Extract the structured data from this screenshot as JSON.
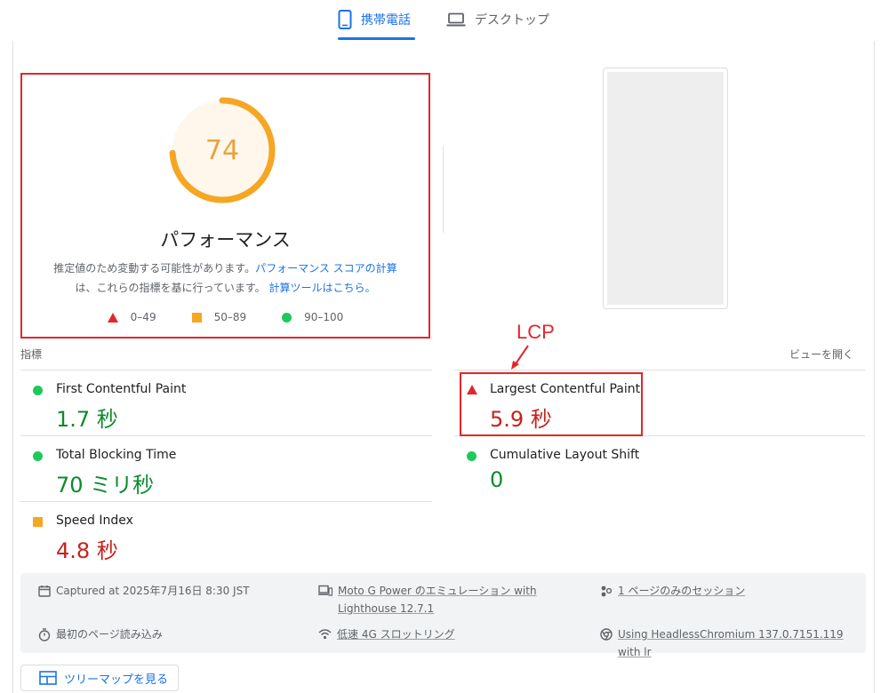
{
  "tabs": {
    "mobile_label": "携帯電話",
    "desktop_label": "デスクトップ"
  },
  "score": {
    "value": 74,
    "title": "パフォーマンス",
    "desc_part1": "推定値のため変動する可能性があります。",
    "desc_link1": "パフォーマンス スコアの計算",
    "desc_part2": "は、これらの指標を基に行っています。",
    "desc_link2": "計算ツールはこちら。",
    "legend": [
      "0–49",
      "50–89",
      "90–100"
    ],
    "color": "#f5a623"
  },
  "annotation": {
    "lcp_label": "LCP"
  },
  "metrics_header": {
    "label": "指標",
    "expand": "ビューを開く"
  },
  "metrics": {
    "fcp": {
      "name": "First Contentful Paint",
      "value": "1.7 秒",
      "status": "good"
    },
    "lcp": {
      "name": "Largest Contentful Paint",
      "value": "5.9 秒",
      "status": "poor"
    },
    "tbt": {
      "name": "Total Blocking Time",
      "value": "70 ミリ秒",
      "status": "good"
    },
    "cls": {
      "name": "Cumulative Layout Shift",
      "value": "0",
      "status": "good"
    },
    "si": {
      "name": "Speed Index",
      "value": "4.8 秒",
      "status": "poor"
    }
  },
  "info": {
    "captured": "Captured at 2025年7月16日 8:30 JST",
    "device_line1": "Moto G Power のエミュレーション with",
    "device_line2": "Lighthouse 12.7.1",
    "session": "1 ページのみのセッション",
    "load": "最初のページ読み込み",
    "network": "低速 4G スロットリング",
    "browser": "Using HeadlessChromium 137.0.7151.119 with lr"
  },
  "treemap": {
    "label": "ツリーマップを見る"
  },
  "colors": {
    "good": "#0c8a2c",
    "poor": "#c5221f",
    "accent": "#1a73e8",
    "highlight": "#e3262b"
  }
}
